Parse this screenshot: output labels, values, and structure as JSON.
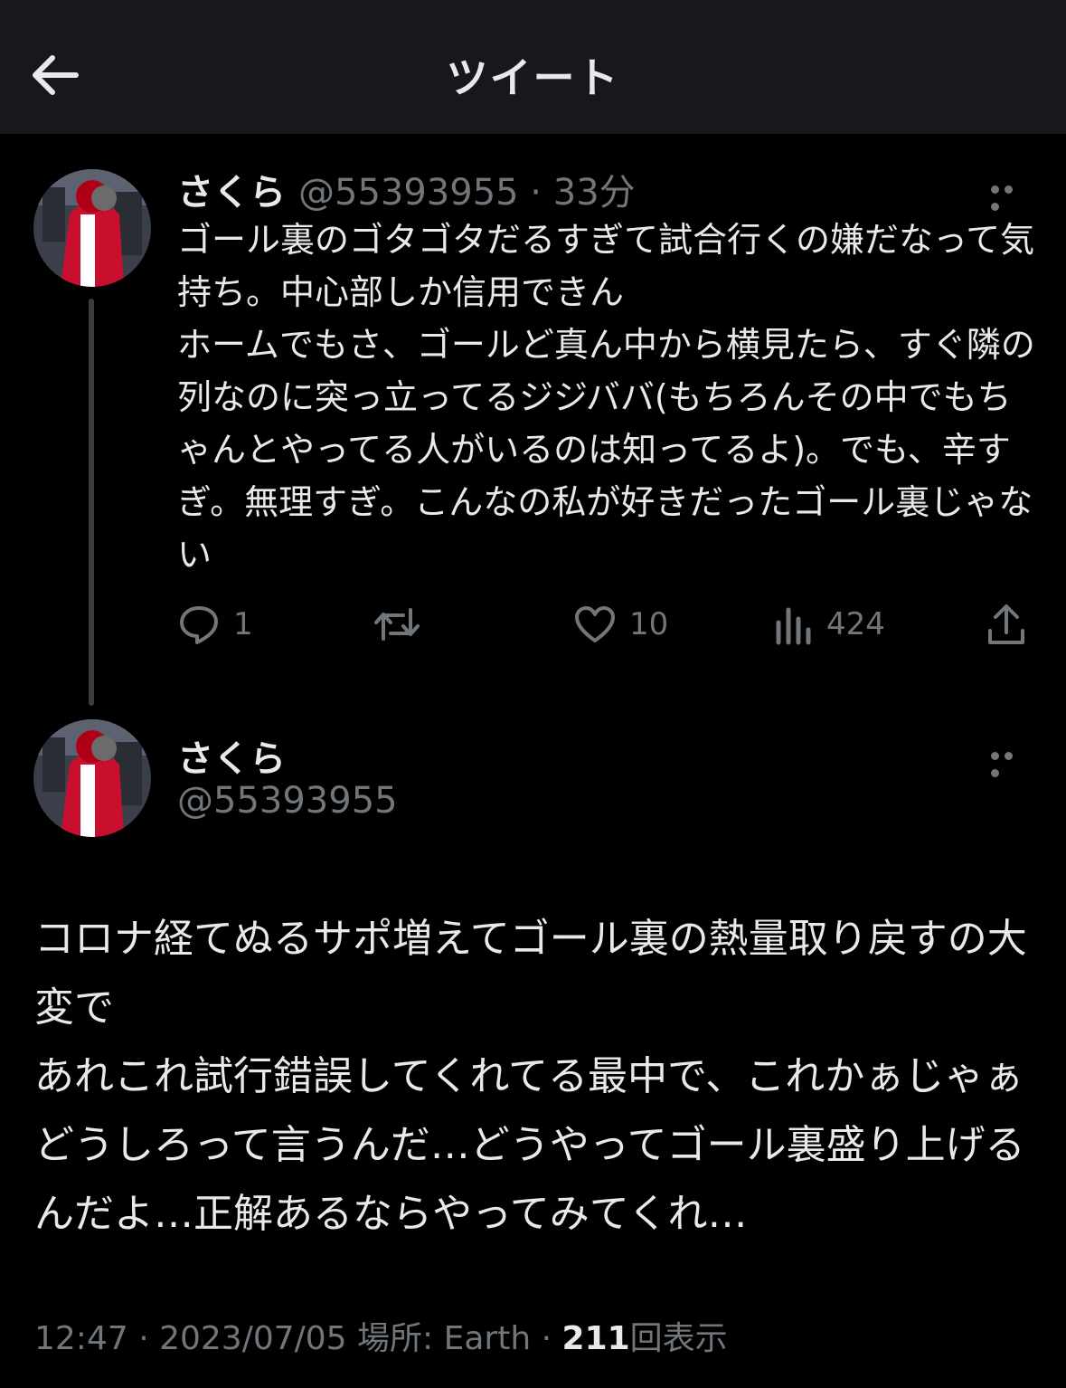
{
  "header": {
    "title": "ツイート"
  },
  "tweet1": {
    "name": "さくら",
    "handle": "@55393955",
    "time": "33分",
    "text": "ゴール裏のゴタゴタだるすぎて試合行くの嫌だなって気持ち。中心部しか信用できん\nホームでもさ、ゴールど真ん中から横見たら、すぐ隣の列なのに突っ立ってるジジババ(もちろんその中でもちゃんとやってる人がいるのは知ってるよ)。でも、辛すぎ。無理すぎ。こんなの私が好きだったゴール裏じゃない",
    "actions": {
      "replies": "1",
      "retweets": "",
      "likes": "10",
      "views": "424"
    }
  },
  "tweet2": {
    "name": "さくら",
    "handle": "@55393955",
    "text": "コロナ経てぬるサポ増えてゴール裏の熱量取り戻すの大変で\nあれこれ試行錯誤してくれてる最中で、これかぁじゃぁどうしろって言うんだ…どうやってゴール裏盛り上げるんだよ…正解あるならやってみてくれ…"
  },
  "meta": {
    "time": "12:47",
    "date": "2023/07/05",
    "location": "場所: Earth",
    "views_count": "211",
    "views_label": "回表示"
  },
  "colors": {
    "background": "#000000",
    "header": "#16181c",
    "text": "#e7e9ea",
    "muted": "#71767b"
  },
  "icons": [
    "back-arrow-icon",
    "more-icon",
    "reply-icon",
    "retweet-icon",
    "like-icon",
    "views-icon",
    "share-icon"
  ]
}
